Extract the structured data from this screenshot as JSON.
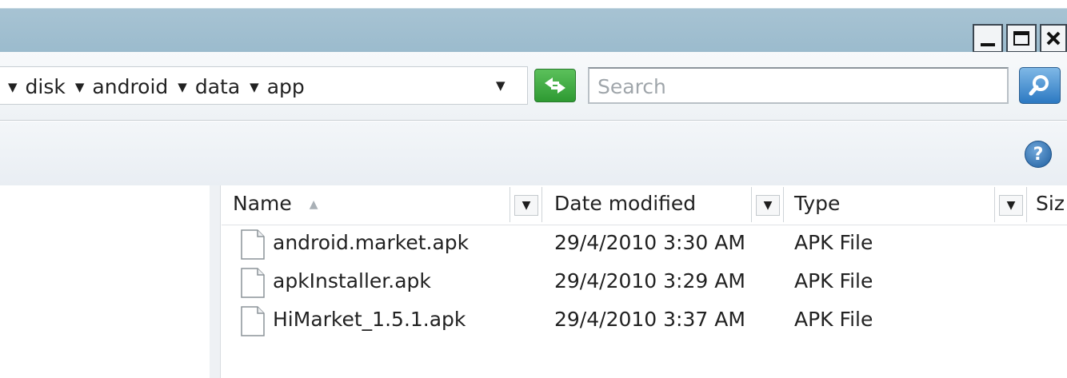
{
  "breadcrumb": [
    "disk",
    "android",
    "data",
    "app"
  ],
  "search": {
    "placeholder": "Search"
  },
  "columns": {
    "name": "Name",
    "date": "Date modified",
    "type": "Type",
    "size": "Siz"
  },
  "files": [
    {
      "name": "android.market.apk",
      "date": "29/4/2010 3:30 AM",
      "type": "APK File"
    },
    {
      "name": "apkInstaller.apk",
      "date": "29/4/2010 3:29 AM",
      "type": "APK File"
    },
    {
      "name": "HiMarket_1.5.1.apk",
      "date": "29/4/2010 3:37 AM",
      "type": "APK File"
    }
  ],
  "icons": {
    "refresh": "refresh-icon",
    "search": "search-icon",
    "help": "help-icon",
    "file": "file-icon"
  },
  "colors": {
    "titlebar": "#a7c3d3",
    "refresh_green": "#2e9a32",
    "search_blue": "#2c79c2"
  }
}
